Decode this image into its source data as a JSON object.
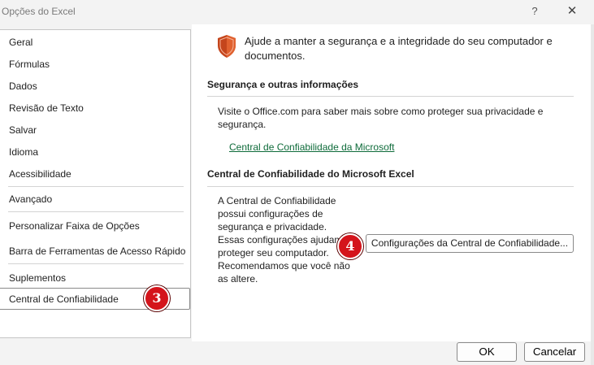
{
  "window": {
    "title": "Opções do Excel",
    "help_glyph": "?",
    "close_glyph": "✕"
  },
  "sidebar": {
    "items": [
      {
        "label": "Geral"
      },
      {
        "label": "Fórmulas"
      },
      {
        "label": "Dados"
      },
      {
        "label": "Revisão de Texto"
      },
      {
        "label": "Salvar"
      },
      {
        "label": "Idioma"
      },
      {
        "label": "Acessibilidade"
      },
      {
        "label": "Avançado"
      },
      {
        "label": "Personalizar Faixa de Opções"
      },
      {
        "label": "Barra de Ferramentas de Acesso Rápido"
      },
      {
        "label": "Suplementos"
      },
      {
        "label": "Central de Confiabilidade"
      }
    ],
    "selected": "Central de Confiabilidade"
  },
  "annotations": {
    "step3": "3",
    "step4": "4",
    "badge_color": "#d4141b"
  },
  "main": {
    "header_icon": "shield-icon",
    "header_text": "Ajude a manter a segurança e a integridade do seu computador e documentos.",
    "section1": {
      "title": "Segurança e outras informações",
      "text": "Visite o Office.com para saber mais sobre como proteger sua privacidade e segurança.",
      "link": "Central de Confiabilidade da Microsoft",
      "link_color": "#0e6b3a"
    },
    "section2": {
      "title": "Central de Confiabilidade do Microsoft Excel",
      "text": "A Central de Confiabilidade possui configurações de segurança e privacidade. Essas configurações ajudam a proteger seu computador. Recomendamos que você não as altere.",
      "button": "Configurações da Central de Confiabilidade..."
    }
  },
  "footer": {
    "ok": "OK",
    "cancel": "Cancelar"
  }
}
